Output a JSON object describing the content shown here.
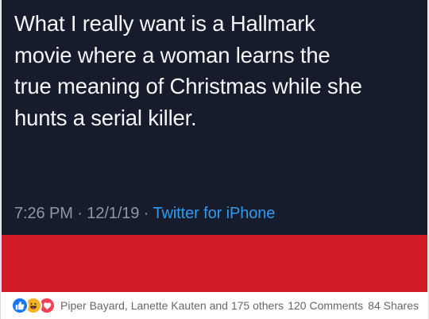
{
  "tweet": {
    "text_lines": [
      "What I really want is a Hallmark",
      "movie where a woman learns the",
      "true meaning of Christmas while she",
      "hunts a serial killer."
    ],
    "time": "7:26 PM",
    "date": "12/1/19",
    "separator": "·",
    "source": "Twitter for iPhone",
    "colors": {
      "background": "#161c2b",
      "text": "#f4f5f7",
      "meta": "#8f98a6",
      "link": "#2f9bf0"
    }
  },
  "banner": {
    "color": "#d11b26"
  },
  "footer": {
    "reaction_icons": [
      "like-icon",
      "haha-icon",
      "love-icon"
    ],
    "reactors": "Piper Bayard, Lanette Kauten and 175 others",
    "comments": "120 Comments",
    "shares": "84 Shares"
  }
}
